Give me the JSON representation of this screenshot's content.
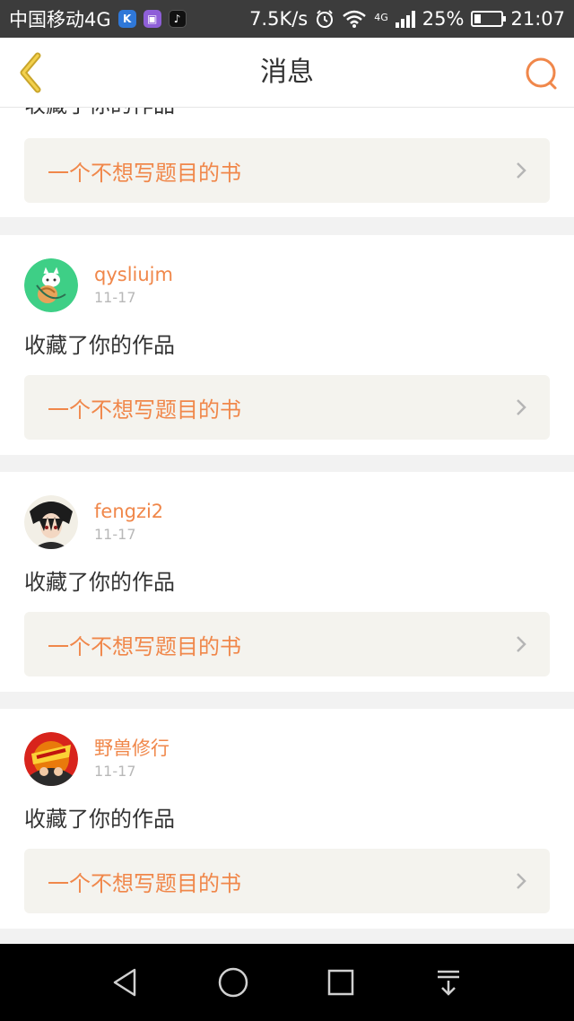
{
  "status_bar": {
    "carrier": "中国移动4G",
    "speed": "7.5K/s",
    "network_label": "4G",
    "battery": "25%",
    "time": "21:07"
  },
  "header": {
    "title": "消息"
  },
  "colors": {
    "accent": "#f0874a",
    "back_arrow": "#c9a52b",
    "book_box_bg": "#f4f3ee"
  },
  "feed": {
    "partial_action_text": "收藏了你的作品",
    "items": [
      {
        "book_title": "一个不想写题目的书"
      },
      {
        "username": "qysliujm",
        "date": "11-17",
        "action_text": "收藏了你的作品",
        "book_title": "一个不想写题目的书"
      },
      {
        "username": "fengzi2",
        "date": "11-17",
        "action_text": "收藏了你的作品",
        "book_title": "一个不想写题目的书"
      },
      {
        "username": "野兽修行",
        "date": "11-17",
        "action_text": "收藏了你的作品",
        "book_title": "一个不想写题目的书"
      }
    ]
  },
  "icons": {
    "back": "chevron-left-icon",
    "search": "search-icon",
    "nav": [
      "back-triangle-icon",
      "home-circle-icon",
      "recents-square-icon",
      "notification-pull-icon"
    ]
  }
}
